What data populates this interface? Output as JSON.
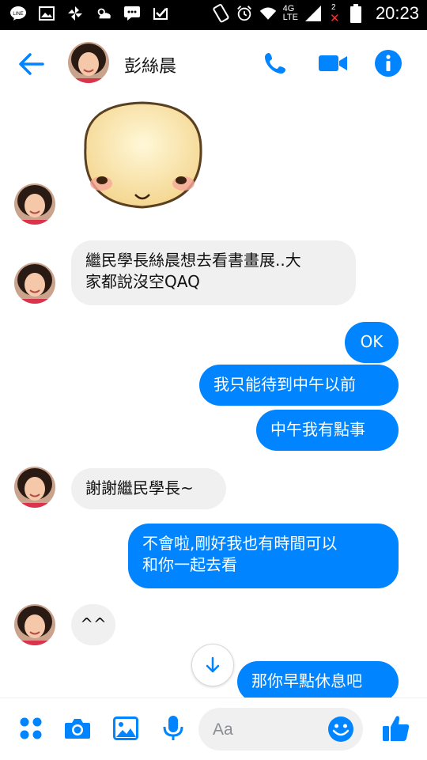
{
  "status_bar": {
    "time": "20:23",
    "network": "4G",
    "network_sub": "LTE",
    "notif_count": "2",
    "left_icons": [
      "line-app-icon",
      "gallery-icon",
      "pinwheel-icon",
      "weather-icon",
      "chat-icon",
      "check-icon"
    ]
  },
  "header": {
    "contact_name": "彭絲晨"
  },
  "colors": {
    "accent": "#0084ff",
    "incoming_bg": "#f1f0f0",
    "statusbar_bg": "#000000"
  },
  "messages": {
    "m1": {
      "line1": "繼民學長絲晨想去看書畫展..大",
      "line2": "家都說沒空QAQ"
    },
    "m2": "OK",
    "m3": "我只能待到中午以前",
    "m4": "中午我有點事",
    "m5": "謝謝繼民學長~",
    "m6": {
      "line1": "不會啦,剛好我也有時間可以",
      "line2": "和你一起去看"
    },
    "m7": "^^",
    "m8": "那你早點休息吧"
  },
  "composer": {
    "placeholder": "Aa"
  }
}
